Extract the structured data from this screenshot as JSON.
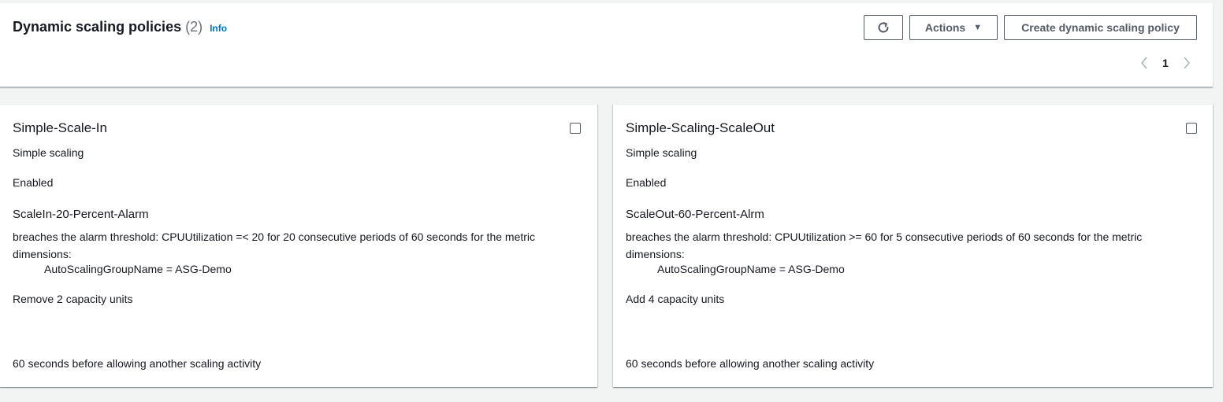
{
  "header": {
    "title": "Dynamic scaling policies",
    "count": "(2)",
    "info": "Info",
    "actions_label": "Actions",
    "create_label": "Create dynamic scaling policy",
    "refresh_icon": "refresh-icon",
    "caret_icon": "caret-down-icon"
  },
  "pagination": {
    "current_page": "1"
  },
  "policies": [
    {
      "name": "Simple-Scale-In",
      "type": "Simple scaling",
      "status": "Enabled",
      "alarm": "ScaleIn-20-Percent-Alarm",
      "description": "breaches the alarm threshold: CPUUtilization =< 20 for 20 consecutive periods of 60 seconds for the metric dimensions:",
      "dimension": "AutoScalingGroupName = ASG-Demo",
      "action": "Remove 2 capacity units",
      "cooldown": "60 seconds before allowing another scaling activity"
    },
    {
      "name": "Simple-Scaling-ScaleOut",
      "type": "Simple scaling",
      "status": "Enabled",
      "alarm": "ScaleOut-60-Percent-Alrm",
      "description": "breaches the alarm threshold: CPUUtilization >= 60 for 5 consecutive periods of 60 seconds for the metric dimensions:",
      "dimension": "AutoScalingGroupName = ASG-Demo",
      "action": "Add 4 capacity units",
      "cooldown": "60 seconds before allowing another scaling activity"
    }
  ],
  "colors": {
    "link": "#0073bb",
    "text": "#16191f",
    "muted": "#687078",
    "background": "#f2f3f3"
  }
}
